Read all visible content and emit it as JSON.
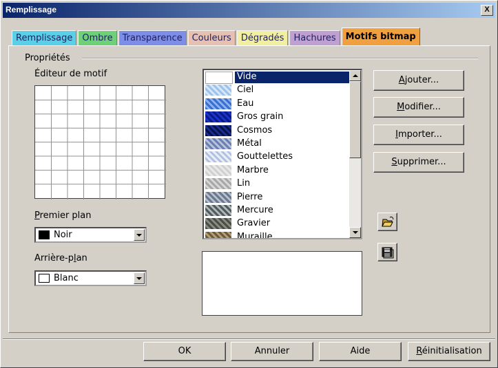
{
  "window": {
    "title": "Remplissage",
    "close_glyph": "X"
  },
  "tabs": [
    {
      "label": "Remplissage",
      "color": "#5ad0e8"
    },
    {
      "label": "Ombre",
      "color": "#6fd07a"
    },
    {
      "label": "Transparence",
      "color": "#7d8ee8"
    },
    {
      "label": "Couleurs",
      "color": "#e6c0b0"
    },
    {
      "label": "Dégradés",
      "color": "#f2f0a0"
    },
    {
      "label": "Hachures",
      "color": "#c0a0d0"
    },
    {
      "label": "Motifs bitmap",
      "color": "#f0a040",
      "active": true
    }
  ],
  "properties": {
    "group_label": "Propriétés",
    "pattern_editor_label": "Éditeur de motif",
    "foreground": {
      "label_first": "P",
      "label_rest": "remier plan",
      "value": "Noir",
      "swatch": "#000000"
    },
    "background": {
      "label_first": "Arrière-p",
      "label_u": "l",
      "label_rest": "an",
      "value": "Blanc",
      "swatch": "#ffffff"
    }
  },
  "bitmaps": [
    {
      "name": "Vide",
      "selected": true,
      "colors": [
        "#ffffff",
        "#ffffff"
      ]
    },
    {
      "name": "Ciel",
      "colors": [
        "#9ec3ea",
        "#d9e8f8"
      ]
    },
    {
      "name": "Eau",
      "colors": [
        "#3a6fd0",
        "#8db3f0"
      ]
    },
    {
      "name": "Gros grain",
      "colors": [
        "#0a1a8a",
        "#1c34c8"
      ]
    },
    {
      "name": "Cosmos",
      "colors": [
        "#06104a",
        "#1a2f90"
      ]
    },
    {
      "name": "Métal",
      "colors": [
        "#6d7fb0",
        "#b8c4de"
      ]
    },
    {
      "name": "Gouttelettes",
      "colors": [
        "#e8ecf4",
        "#b0c0e0"
      ]
    },
    {
      "name": "Marbre",
      "colors": [
        "#e8e8e8",
        "#cfcfcf"
      ]
    },
    {
      "name": "Lin",
      "colors": [
        "#a8a8a8",
        "#d8d8d8"
      ]
    },
    {
      "name": "Pierre",
      "colors": [
        "#6a7890",
        "#b8c0cc"
      ]
    },
    {
      "name": "Mercure",
      "colors": [
        "#505a60",
        "#b0b8b8"
      ]
    },
    {
      "name": "Gravier",
      "colors": [
        "#4a4e48",
        "#8a8e80"
      ]
    },
    {
      "name": "Muraille",
      "colors": [
        "#6a5a40",
        "#b8a070"
      ]
    }
  ],
  "buttons": {
    "add": {
      "u": "A",
      "rest": "jouter..."
    },
    "modify": {
      "u": "M",
      "rest": "odifier..."
    },
    "import": {
      "u": "I",
      "rest": "mporter..."
    },
    "delete": {
      "u": "S",
      "rest": "upprimer..."
    }
  },
  "footer": {
    "ok": "OK",
    "cancel": "Annuler",
    "help": "Aide",
    "reset_u": "R",
    "reset_rest": "éinitialisation"
  },
  "icons": {
    "open": "open-folder-icon",
    "save": "save-disk-icon"
  }
}
